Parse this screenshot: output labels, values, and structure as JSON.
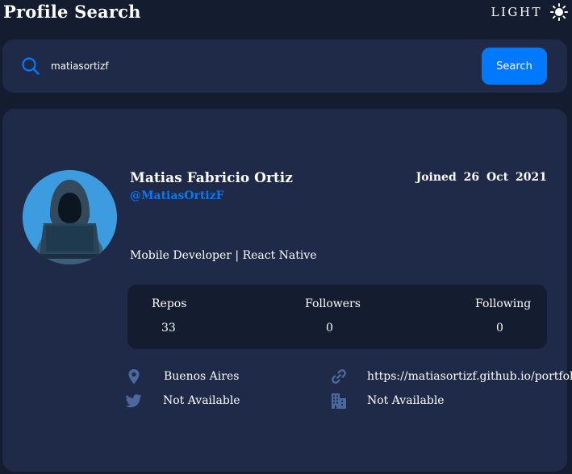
{
  "header": {
    "title": "Profile Search",
    "theme_toggle": {
      "label": "LIGHT",
      "icon": "sun-icon"
    }
  },
  "search": {
    "value": "matiasortizf",
    "icon": "search-icon",
    "button_label": "Search"
  },
  "profile": {
    "avatar_icon": "hooded-hacker-avatar",
    "name": "Matias Fabricio Ortiz",
    "login": "@MatiasOrtizF",
    "joined": "Joined 26 Oct 2021",
    "bio": "Mobile Developer | React Native",
    "stats": {
      "repos_label": "Repos",
      "repos": "33",
      "followers_label": "Followers",
      "followers": "0",
      "following_label": "Following",
      "following": "0"
    },
    "info": {
      "location": "Buenos Aires",
      "blog": "https://matiasortizf.github.io/portfolio/",
      "twitter": "Not Available",
      "company": "Not Available"
    }
  },
  "colors": {
    "background": "#141d2f",
    "card": "#1e2a47",
    "accent": "#0079ff",
    "icon_muted": "#4b6a9b"
  }
}
